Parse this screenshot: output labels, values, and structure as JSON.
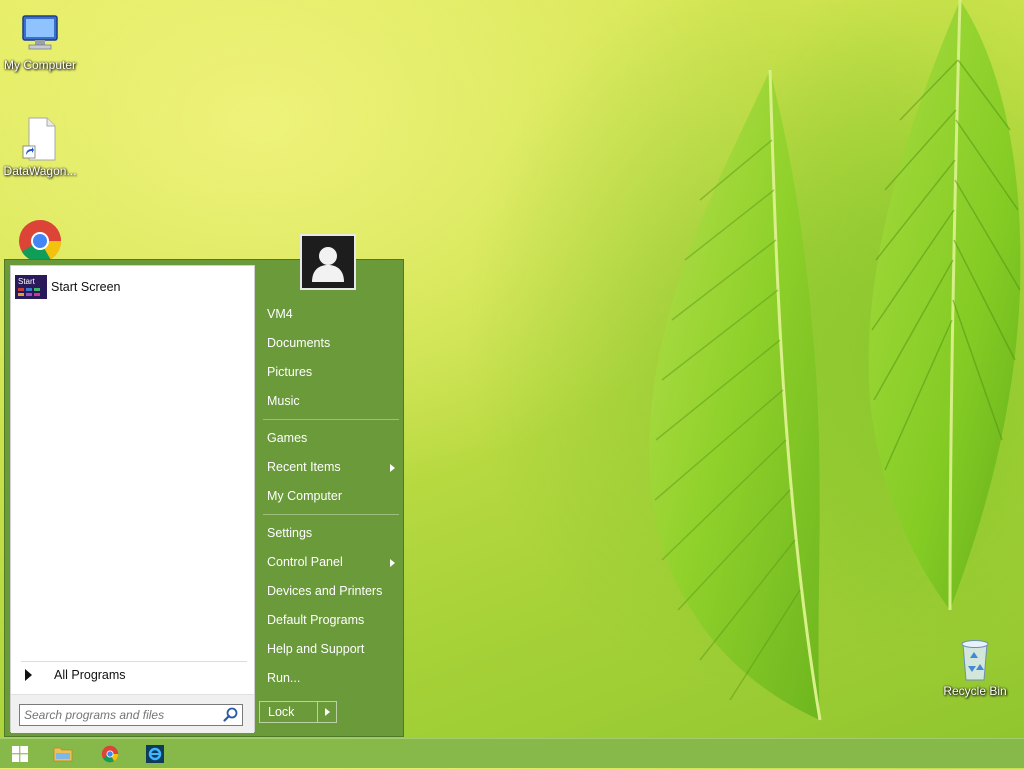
{
  "desktop": {
    "icons": [
      {
        "label": "My Computer",
        "icon": "computer-icon"
      },
      {
        "label": "DataWagon...",
        "icon": "file-shortcut-icon"
      },
      {
        "label": "",
        "icon": "chrome-icon"
      },
      {
        "label": "Recycle Bin",
        "icon": "recycle-bin-icon"
      }
    ]
  },
  "start_menu": {
    "user_tile_icon": "user-avatar-icon",
    "pinned": [
      {
        "label": "Start Screen",
        "icon_text": "Start",
        "icon": "start-screen-icon"
      }
    ],
    "all_programs_label": "All Programs",
    "search_placeholder": "Search programs and files",
    "right_items": [
      {
        "label": "VM4",
        "submenu": false
      },
      {
        "label": "Documents",
        "submenu": false
      },
      {
        "label": "Pictures",
        "submenu": false
      },
      {
        "label": "Music",
        "submenu": false
      },
      {
        "label": "Games",
        "submenu": false
      },
      {
        "label": "Recent Items",
        "submenu": true
      },
      {
        "label": "My Computer",
        "submenu": false
      },
      {
        "label": "Settings",
        "submenu": false
      },
      {
        "label": "Control Panel",
        "submenu": true
      },
      {
        "label": "Devices and Printers",
        "submenu": false
      },
      {
        "label": "Default Programs",
        "submenu": false
      },
      {
        "label": "Help and Support",
        "submenu": false
      },
      {
        "label": "Run...",
        "submenu": false
      }
    ],
    "lock_label": "Lock"
  },
  "taskbar": {
    "items": [
      "windows-start-icon",
      "file-explorer-icon",
      "chrome-icon",
      "ie-icon"
    ]
  },
  "colors": {
    "menu_green": "#6a9a3a",
    "taskbar_green": "#86b94a"
  }
}
